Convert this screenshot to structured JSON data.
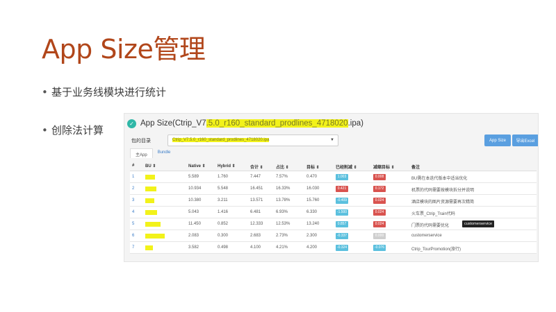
{
  "slide": {
    "title": "App Size管理",
    "bullets": [
      "基于业务线模块进行统计",
      "创除法计算"
    ]
  },
  "screenshot": {
    "app_title_prefix": "App Size(Ctrip_V7",
    "app_title_highlight": ".5.0_r160_standard_prodlines_4718020",
    "app_title_suffix": ".ipa)",
    "filter_label": "包的目录",
    "select_value": "Ctrip_V7.5.0_r160_standard_prodlines_4718020.ipa",
    "buttons": [
      "App Size",
      "导出Excel"
    ],
    "tabs": [
      "主App",
      "Bundle"
    ],
    "columns": [
      "#",
      "BU ⇕",
      "Native ⇕",
      "Hybrid ⇕",
      "合计 ⇕",
      "占比 ⇕",
      "目标 ⇕",
      "已经削减 ⇕",
      "减缩目标 ⇕",
      "备注"
    ],
    "rows": [
      {
        "idx": "1",
        "native": "5.589",
        "hybrid": "1.760",
        "total": "7.447",
        "pct": "7.57%",
        "target": "0.470",
        "b1": "1.003",
        "b1c": "blue",
        "b2": "0.008",
        "b2c": "red",
        "note": "BU需在本迭代版本中适当优化"
      },
      {
        "idx": "2",
        "native": "10.934",
        "hybrid": "5.548",
        "total": "16.451",
        "pct": "16.33%",
        "target": "16.030",
        "b1": "0.421",
        "b1c": "red",
        "b2": "0.172",
        "b2c": "red",
        "note": "机票的代码需要按模块拆分并说明"
      },
      {
        "idx": "3",
        "native": "10.380",
        "hybrid": "3.211",
        "total": "13.571",
        "pct": "13.78%",
        "target": "15.760",
        "b1": "-0.409",
        "b1c": "blue",
        "b2": "0.024",
        "b2c": "red",
        "note": "酒店模块的图片资源需要再次精简"
      },
      {
        "idx": "4",
        "native": "5.043",
        "hybrid": "1.416",
        "total": "6.481",
        "pct": "6.93%",
        "target": "6.330",
        "b1": "-1.500",
        "b1c": "blue",
        "b2": "0.024",
        "b2c": "red",
        "note": "火车票_Ctrip_Train代码"
      },
      {
        "idx": "5",
        "native": "11.450",
        "hybrid": "0.852",
        "total": "12.333",
        "pct": "12.53%",
        "target": "13.240",
        "b1": "0.857",
        "b1c": "blue",
        "b2": "0.024",
        "b2c": "red",
        "note": "门票的代码需要优化",
        "tooltip": "customerservice"
      },
      {
        "idx": "6",
        "native": "2.083",
        "hybrid": "0.300",
        "total": "2.683",
        "pct": "2.73%",
        "target": "2.300",
        "b1": "-0.337",
        "b1c": "blue",
        "b2": "0.000",
        "b2c": "gray",
        "note": "customerservice"
      },
      {
        "idx": "7",
        "native": "3.582",
        "hybrid": "0.498",
        "total": "4.100",
        "pct": "4.21%",
        "target": "4.200",
        "b1": "-0.324",
        "b1c": "blue",
        "b2": "-0.076",
        "b2c": "blue",
        "note": "Ctrip_TourPromotion(旅行)"
      }
    ]
  }
}
